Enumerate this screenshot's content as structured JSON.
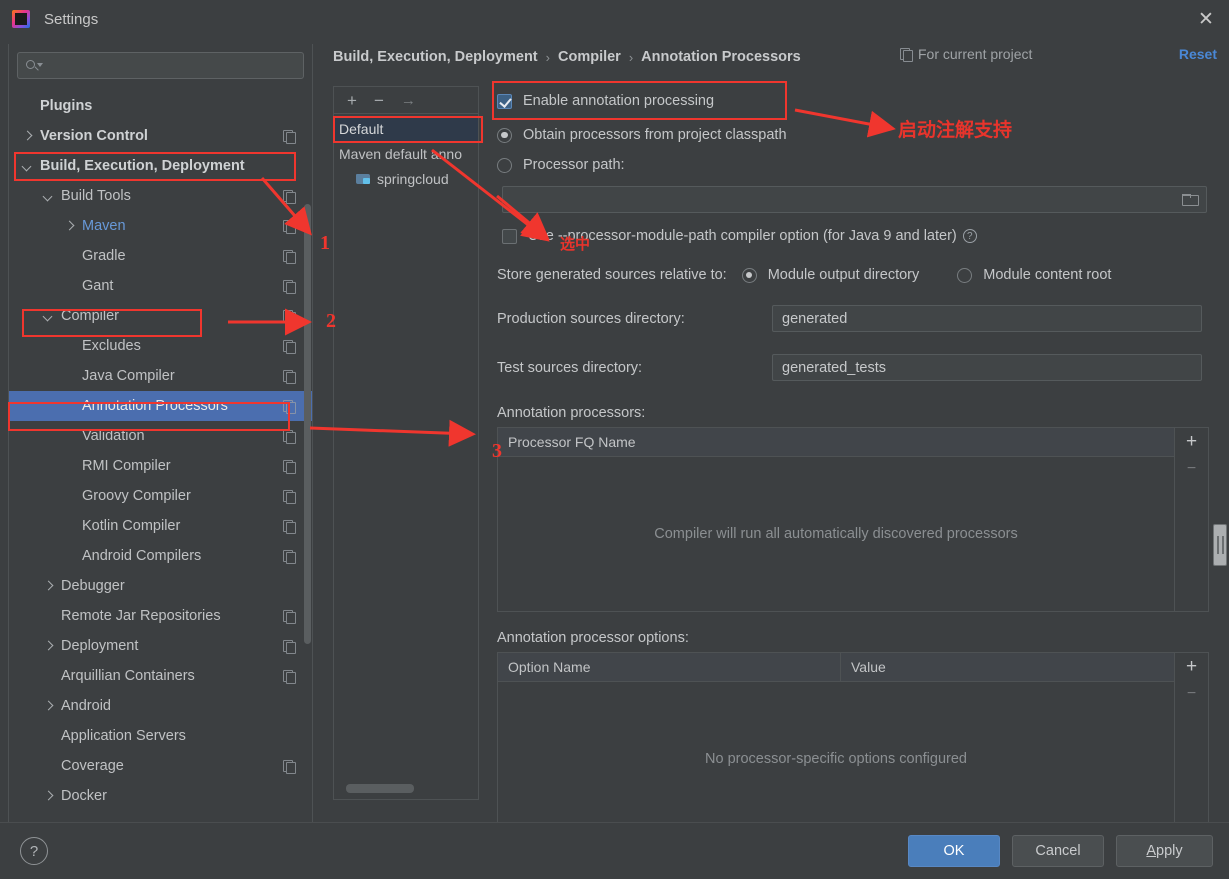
{
  "window": {
    "title": "Settings",
    "app_icon": "intellij-idea-icon",
    "close_icon": "close-icon"
  },
  "sidebar": {
    "search": {
      "placeholder": "",
      "value": "",
      "icon": "search-icon"
    },
    "items": [
      {
        "label": "Plugins",
        "indent": 0,
        "arrow": "none",
        "bold": true,
        "copy": false,
        "selected": false,
        "link": false
      },
      {
        "label": "Version Control",
        "indent": 0,
        "arrow": "right",
        "bold": true,
        "copy": true,
        "selected": false,
        "link": false
      },
      {
        "label": "Build, Execution, Deployment",
        "indent": 0,
        "arrow": "down",
        "bold": true,
        "copy": false,
        "selected": false,
        "link": false
      },
      {
        "label": "Build Tools",
        "indent": 1,
        "arrow": "down",
        "bold": false,
        "copy": true,
        "selected": false,
        "link": false
      },
      {
        "label": "Maven",
        "indent": 2,
        "arrow": "right",
        "bold": false,
        "copy": true,
        "selected": false,
        "link": true
      },
      {
        "label": "Gradle",
        "indent": 2,
        "arrow": "none",
        "bold": false,
        "copy": true,
        "selected": false,
        "link": false
      },
      {
        "label": "Gant",
        "indent": 2,
        "arrow": "none",
        "bold": false,
        "copy": true,
        "selected": false,
        "link": false
      },
      {
        "label": "Compiler",
        "indent": 1,
        "arrow": "down",
        "bold": false,
        "copy": true,
        "selected": false,
        "link": false
      },
      {
        "label": "Excludes",
        "indent": 2,
        "arrow": "none",
        "bold": false,
        "copy": true,
        "selected": false,
        "link": false
      },
      {
        "label": "Java Compiler",
        "indent": 2,
        "arrow": "none",
        "bold": false,
        "copy": true,
        "selected": false,
        "link": false
      },
      {
        "label": "Annotation Processors",
        "indent": 2,
        "arrow": "none",
        "bold": false,
        "copy": true,
        "selected": true,
        "link": false
      },
      {
        "label": "Validation",
        "indent": 2,
        "arrow": "none",
        "bold": false,
        "copy": true,
        "selected": false,
        "link": false
      },
      {
        "label": "RMI Compiler",
        "indent": 2,
        "arrow": "none",
        "bold": false,
        "copy": true,
        "selected": false,
        "link": false
      },
      {
        "label": "Groovy Compiler",
        "indent": 2,
        "arrow": "none",
        "bold": false,
        "copy": true,
        "selected": false,
        "link": false
      },
      {
        "label": "Kotlin Compiler",
        "indent": 2,
        "arrow": "none",
        "bold": false,
        "copy": true,
        "selected": false,
        "link": false
      },
      {
        "label": "Android Compilers",
        "indent": 2,
        "arrow": "none",
        "bold": false,
        "copy": true,
        "selected": false,
        "link": false
      },
      {
        "label": "Debugger",
        "indent": 1,
        "arrow": "right",
        "bold": false,
        "copy": false,
        "selected": false,
        "link": false
      },
      {
        "label": "Remote Jar Repositories",
        "indent": 1,
        "arrow": "none",
        "bold": false,
        "copy": true,
        "selected": false,
        "link": false
      },
      {
        "label": "Deployment",
        "indent": 1,
        "arrow": "right",
        "bold": false,
        "copy": true,
        "selected": false,
        "link": false
      },
      {
        "label": "Arquillian Containers",
        "indent": 1,
        "arrow": "none",
        "bold": false,
        "copy": true,
        "selected": false,
        "link": false
      },
      {
        "label": "Android",
        "indent": 1,
        "arrow": "right",
        "bold": false,
        "copy": false,
        "selected": false,
        "link": false
      },
      {
        "label": "Application Servers",
        "indent": 1,
        "arrow": "none",
        "bold": false,
        "copy": false,
        "selected": false,
        "link": false
      },
      {
        "label": "Coverage",
        "indent": 1,
        "arrow": "none",
        "bold": false,
        "copy": true,
        "selected": false,
        "link": false
      },
      {
        "label": "Docker",
        "indent": 1,
        "arrow": "right",
        "bold": false,
        "copy": false,
        "selected": false,
        "link": false
      }
    ]
  },
  "header": {
    "breadcrumb": [
      "Build, Execution, Deployment",
      "Compiler",
      "Annotation Processors"
    ],
    "separator": "›",
    "scope_label": "For current project",
    "scope_icon": "copy-icon",
    "reset_label": "Reset"
  },
  "module_panel": {
    "toolbar": {
      "add": "+",
      "remove": "−",
      "move": "→"
    },
    "items": [
      {
        "label": "Default",
        "selected": true,
        "folder": false
      },
      {
        "label": "Maven default anno",
        "selected": false,
        "folder": false
      },
      {
        "label": "springcloud",
        "selected": false,
        "folder": true
      }
    ]
  },
  "form": {
    "enable_annotation_processing": {
      "label": "Enable annotation processing",
      "checked": true
    },
    "source_option": {
      "obtain_from_classpath": {
        "label": "Obtain processors from project classpath",
        "selected": true
      },
      "processor_path": {
        "label": "Processor path:",
        "selected": false,
        "value": ""
      }
    },
    "use_processor_module_path": {
      "label": "Use --processor-module-path compiler option (for Java 9 and later)",
      "checked": false,
      "help_icon": "question-mark-icon"
    },
    "store_relative_label": "Store generated sources relative to:",
    "store_options": [
      {
        "label": "Module output directory",
        "selected": true
      },
      {
        "label": "Module content root",
        "selected": false
      }
    ],
    "production_sources": {
      "label": "Production sources directory:",
      "value": "generated"
    },
    "test_sources": {
      "label": "Test sources directory:",
      "value": "generated_tests"
    },
    "processors_table": {
      "title": "Annotation processors:",
      "columns": [
        "Processor FQ Name"
      ],
      "empty_text": "Compiler will run all automatically discovered processors",
      "add_btn": "+",
      "remove_btn": "−"
    },
    "options_table": {
      "title": "Annotation processor options:",
      "columns": [
        "Option Name",
        "Value"
      ],
      "empty_text": "No processor-specific options configured",
      "add_btn": "+",
      "remove_btn": "−"
    }
  },
  "footer": {
    "help_icon": "question-mark-icon",
    "ok_label": "OK",
    "cancel_label": "Cancel",
    "apply_label": "Apply"
  },
  "annotations": {
    "color": "#f0362e",
    "numbers": [
      "1",
      "2",
      "3"
    ],
    "note_enable": "启动注解支持",
    "note_select": "选中"
  }
}
